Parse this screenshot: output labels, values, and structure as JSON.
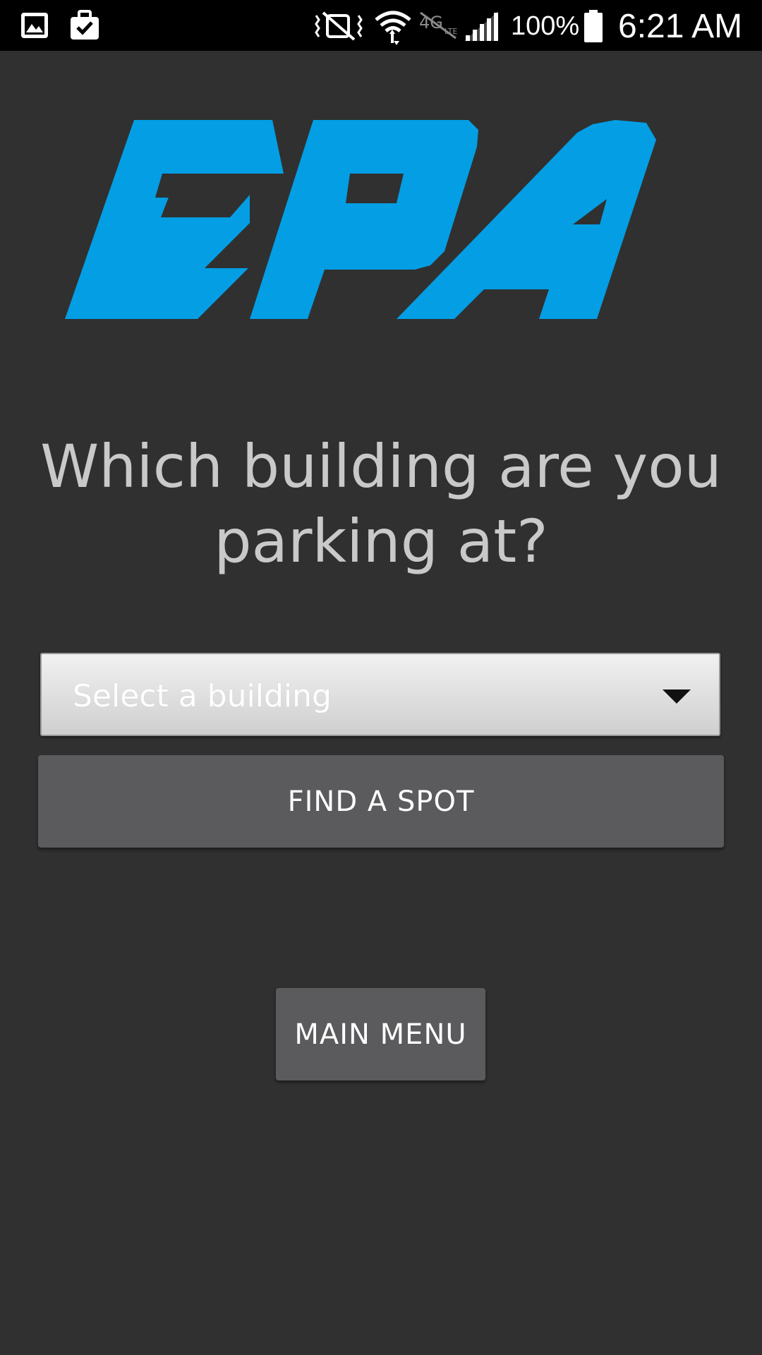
{
  "status_bar": {
    "icons": [
      "gallery-icon",
      "briefcase-icon",
      "mute-icon",
      "wifi-icon",
      "lte-icon",
      "signal-icon",
      "battery-icon"
    ],
    "battery_percent": "100%",
    "time": "6:21 AM"
  },
  "logo": {
    "text": "EPA",
    "color": "#039EE3"
  },
  "prompt": {
    "question": "Which building are you parking at?"
  },
  "building_select": {
    "selected": "Select a building"
  },
  "actions": {
    "find_spot_label": "FIND A SPOT",
    "main_menu_label": "MAIN MENU"
  },
  "colors": {
    "background": "#303030",
    "button": "#5B5B5D",
    "prompt_text": "#C9C9C9"
  }
}
